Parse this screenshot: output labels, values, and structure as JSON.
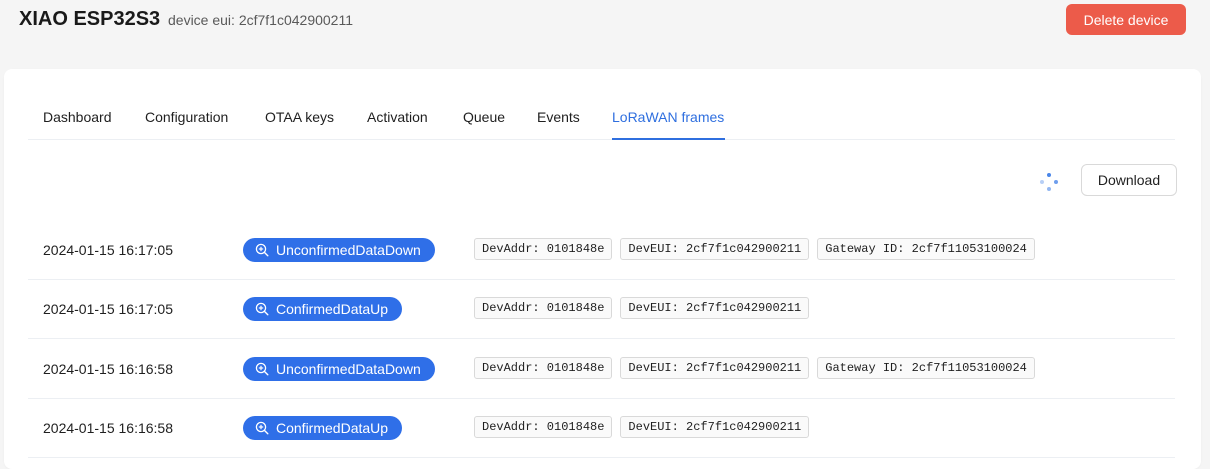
{
  "header": {
    "device_name": "XIAO ESP32S3",
    "device_eui": "device eui: 2cf7f1c042900211",
    "delete_label": "Delete device"
  },
  "tabs": [
    {
      "label": "Dashboard",
      "active": false
    },
    {
      "label": "Configuration",
      "active": false
    },
    {
      "label": "OTAA keys",
      "active": false
    },
    {
      "label": "Activation",
      "active": false
    },
    {
      "label": "Queue",
      "active": false
    },
    {
      "label": "Events",
      "active": false
    },
    {
      "label": "LoRaWAN frames",
      "active": true
    }
  ],
  "toolbar": {
    "download_label": "Download",
    "loading_icon": "loading-dots-icon"
  },
  "colors": {
    "accent": "#2f6fe8",
    "danger": "#ec5b4a"
  },
  "frames": [
    {
      "timestamp": "2024-01-15 16:17:05",
      "type": "UnconfirmedDataDown",
      "dev_addr": "DevAddr: 0101848e",
      "dev_eui": "DevEUI: 2cf7f1c042900211",
      "gateway_id": "Gateway ID: 2cf7f11053100024"
    },
    {
      "timestamp": "2024-01-15 16:17:05",
      "type": "ConfirmedDataUp",
      "dev_addr": "DevAddr: 0101848e",
      "dev_eui": "DevEUI: 2cf7f1c042900211"
    },
    {
      "timestamp": "2024-01-15 16:16:58",
      "type": "UnconfirmedDataDown",
      "dev_addr": "DevAddr: 0101848e",
      "dev_eui": "DevEUI: 2cf7f1c042900211",
      "gateway_id": "Gateway ID: 2cf7f11053100024"
    },
    {
      "timestamp": "2024-01-15 16:16:58",
      "type": "ConfirmedDataUp",
      "dev_addr": "DevAddr: 0101848e",
      "dev_eui": "DevEUI: 2cf7f1c042900211"
    }
  ]
}
